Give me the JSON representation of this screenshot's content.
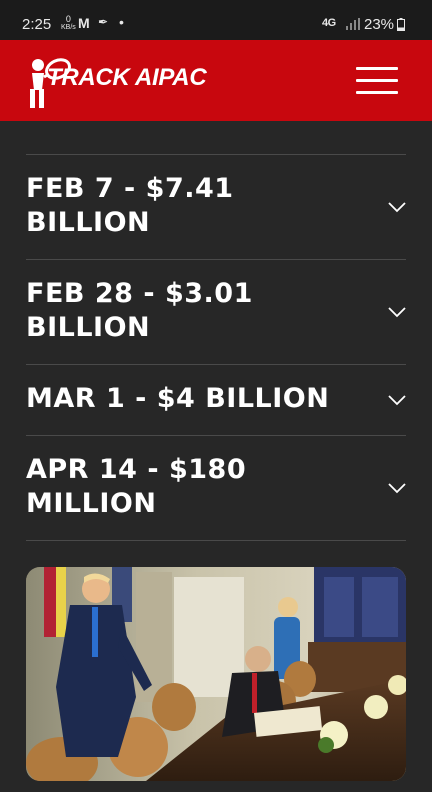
{
  "status_bar": {
    "time": "2:25",
    "data_rate_value": "0",
    "data_rate_unit": "KB/s",
    "network": "4G",
    "battery": "23%"
  },
  "header": {
    "logo_text": "TRACK AIPAC"
  },
  "accordion": [
    {
      "line1": "FEB 7 - $7.41",
      "line2": "BILLION"
    },
    {
      "line1": "FEB 28 - $3.01",
      "line2": "BILLION"
    },
    {
      "line1": "MAR 1 - $4 BILLION",
      "line2": ""
    },
    {
      "line1": "APR 14 - $180",
      "line2": "MILLION"
    }
  ],
  "colors": {
    "brand_red": "#c8070e",
    "background": "#272727",
    "divider": "#4a4a4a"
  },
  "icons": {
    "menu": "hamburger-icon",
    "expand": "chevron-down-icon",
    "logo": "magnifying-glass-figure"
  }
}
